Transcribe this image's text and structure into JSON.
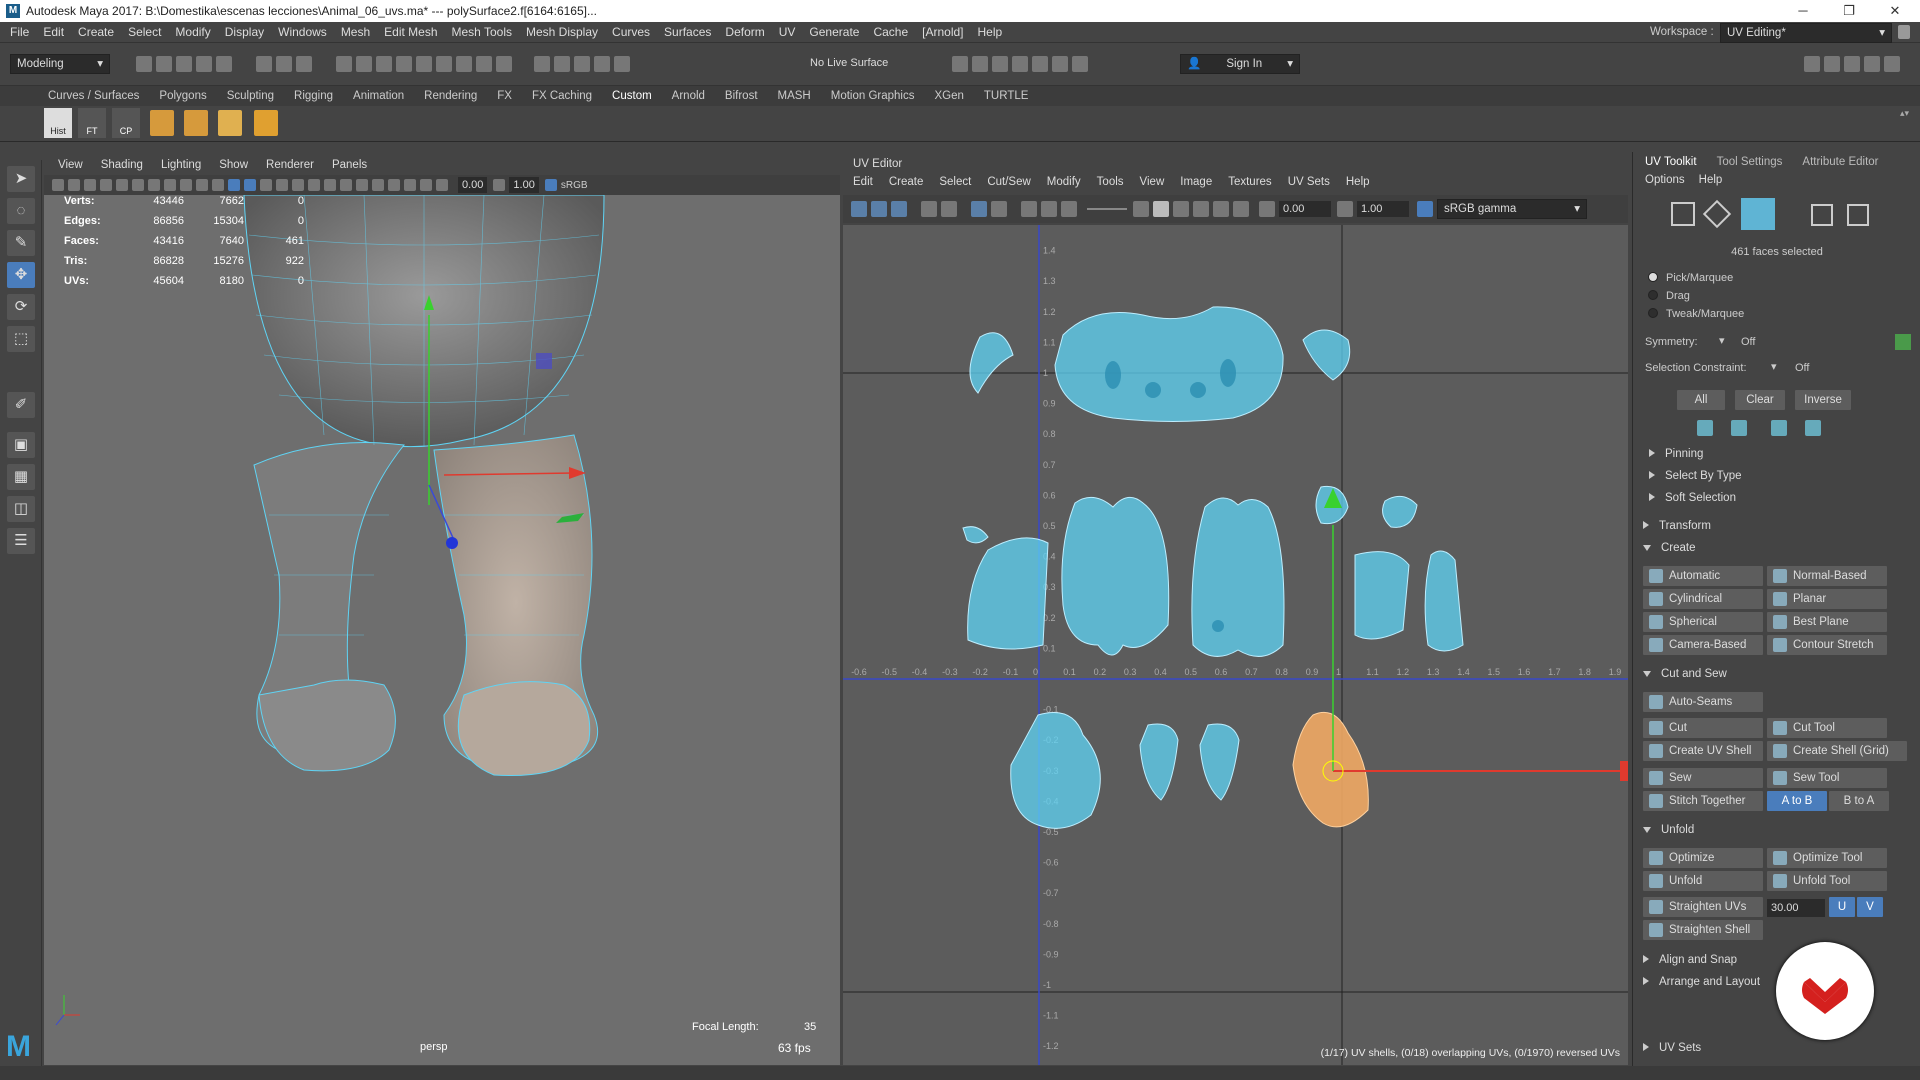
{
  "window": {
    "title": "Autodesk Maya 2017: B:\\Domestika\\escenas lecciones\\Animal_06_uvs.ma*   ---   polySurface2.f[6164:6165]...",
    "minimize": "─",
    "restore": "❐",
    "close": "✕"
  },
  "menubar": {
    "items": [
      "File",
      "Edit",
      "Create",
      "Select",
      "Modify",
      "Display",
      "Windows",
      "Mesh",
      "Edit Mesh",
      "Mesh Tools",
      "Mesh Display",
      "Curves",
      "Surfaces",
      "Deform",
      "UV",
      "Generate",
      "Cache"
    ],
    "arnold": "[Arnold]",
    "help": "Help",
    "workspace_label": "Workspace :",
    "workspace_value": "UV Editing*"
  },
  "statusline": {
    "mode": "Modeling",
    "live_surface": "No Live Surface",
    "sign_in": "Sign In"
  },
  "shelf": {
    "tabs": [
      "Curves / Surfaces",
      "Polygons",
      "Sculpting",
      "Rigging",
      "Animation",
      "Rendering",
      "FX",
      "FX Caching",
      "Custom",
      "Arnold",
      "Bifrost",
      "MASH",
      "Motion Graphics",
      "XGen",
      "TURTLE"
    ],
    "active_tab": "Custom",
    "icons": [
      "Hist",
      "FT",
      "CP",
      "",
      "",
      ""
    ]
  },
  "viewport": {
    "menu": [
      "View",
      "Shading",
      "Lighting",
      "Show",
      "Renderer",
      "Panels"
    ],
    "field1": "0.00",
    "field2": "1.00",
    "field3": "sRGB",
    "hud": [
      {
        "label": "Verts:",
        "v1": "43446",
        "v2": "7662",
        "v3": "0"
      },
      {
        "label": "Edges:",
        "v1": "86856",
        "v2": "15304",
        "v3": "0"
      },
      {
        "label": "Faces:",
        "v1": "43416",
        "v2": "7640",
        "v3": "461"
      },
      {
        "label": "Tris:",
        "v1": "86828",
        "v2": "15276",
        "v3": "922"
      },
      {
        "label": "UVs:",
        "v1": "45604",
        "v2": "8180",
        "v3": "0"
      }
    ],
    "focal_label": "Focal Length:",
    "focal_value": "35",
    "camera": "persp",
    "fps": "63 fps"
  },
  "uv_editor": {
    "title": "UV Editor",
    "menu": [
      "Edit",
      "Create",
      "Select",
      "Cut/Sew",
      "Modify",
      "Tools",
      "View",
      "Image",
      "Textures",
      "UV Sets",
      "Help"
    ],
    "field1": "0.00",
    "field2": "1.00",
    "color_space": "sRGB gamma",
    "u_ticks": [
      "-0.6",
      "-0.5",
      "-0.4",
      "-0.3",
      "-0.2",
      "-0.1",
      "0",
      "0.1",
      "0.2",
      "0.3",
      "0.4",
      "0.5",
      "0.6",
      "0.7",
      "0.8",
      "0.9",
      "1",
      "1.1",
      "1.2",
      "1.3",
      "1.4",
      "1.5",
      "1.6",
      "1.7",
      "1.8",
      "1.9"
    ],
    "v_ticks": [
      "1.4",
      "1.3",
      "1.2",
      "1.1",
      "1",
      "0.9",
      "0.8",
      "0.7",
      "0.6",
      "0.5",
      "0.4",
      "0.3",
      "0.2",
      "0.1",
      "-0.1",
      "-0.2",
      "-0.3",
      "-0.4",
      "-0.5",
      "-0.6",
      "-0.7",
      "-0.8",
      "-0.9",
      "-1",
      "-1.1",
      "-1.2"
    ],
    "status": "(1/17) UV shells, (0/18) overlapping UVs, (0/1970) reversed UVs"
  },
  "right_panel": {
    "tabs": [
      "UV Toolkit",
      "Tool Settings",
      "Attribute Editor"
    ],
    "active_tab": "UV Toolkit",
    "submenu": [
      "Options",
      "Help"
    ],
    "faces_selected": "461 faces selected",
    "modes": [
      "Pick/Marquee",
      "Drag",
      "Tweak/Marquee"
    ],
    "symmetry_label": "Symmetry:",
    "symmetry_value": "Off",
    "constraint_label": "Selection Constraint:",
    "constraint_value": "Off",
    "sel_buttons": [
      "All",
      "Clear",
      "Inverse"
    ],
    "sections": {
      "pinning": "Pinning",
      "select_by_type": "Select By Type",
      "soft_selection": "Soft Selection",
      "transform": "Transform",
      "create": "Create",
      "cut_sew": "Cut and Sew",
      "unfold": "Unfold",
      "align_snap": "Align and Snap",
      "arrange_layout": "Arrange and Layout",
      "uv_sets": "UV Sets"
    },
    "create_buttons": [
      "Automatic",
      "Normal-Based",
      "Cylindrical",
      "Planar",
      "Spherical",
      "Best Plane",
      "Camera-Based",
      "Contour Stretch"
    ],
    "cut_buttons": [
      "Auto-Seams",
      "Cut",
      "Cut Tool",
      "Create UV Shell",
      "Create Shell (Grid)",
      "Sew",
      "Sew Tool",
      "Stitch Together"
    ],
    "stitch_ab": "A to B",
    "stitch_ba": "B to A",
    "unfold_buttons": [
      "Optimize",
      "Optimize Tool",
      "Unfold",
      "Unfold Tool",
      "Straighten UVs",
      "Straighten Shell"
    ],
    "straighten_value": "30.00",
    "u": "U",
    "v": "V"
  },
  "colors": {
    "wire": "#5fd4f5",
    "selected": "#f0a864",
    "accent": "#4a7dbc",
    "badge": "#d4201e"
  }
}
